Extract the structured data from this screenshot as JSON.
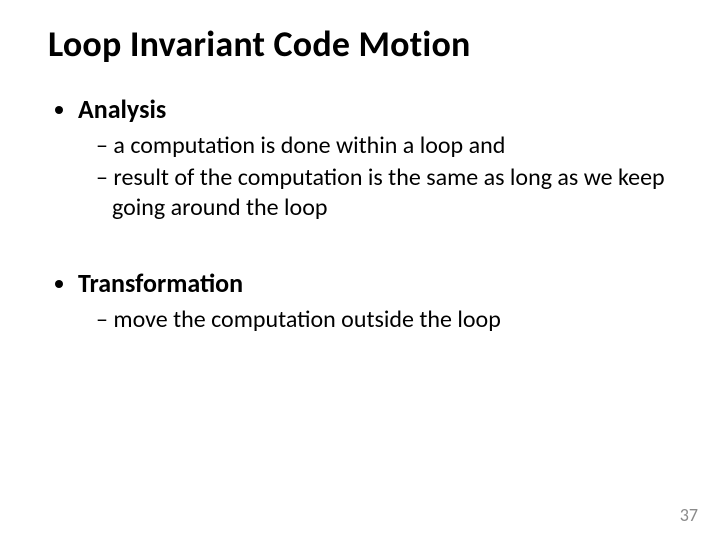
{
  "title": "Loop Invariant Code Motion",
  "sections": [
    {
      "heading": "Analysis",
      "items": [
        "a computation is done within a loop and",
        "result of the computation is the same as long as we keep going around the loop"
      ]
    },
    {
      "heading": "Transformation",
      "items": [
        "move the computation outside the loop"
      ]
    }
  ],
  "page_number": "37"
}
